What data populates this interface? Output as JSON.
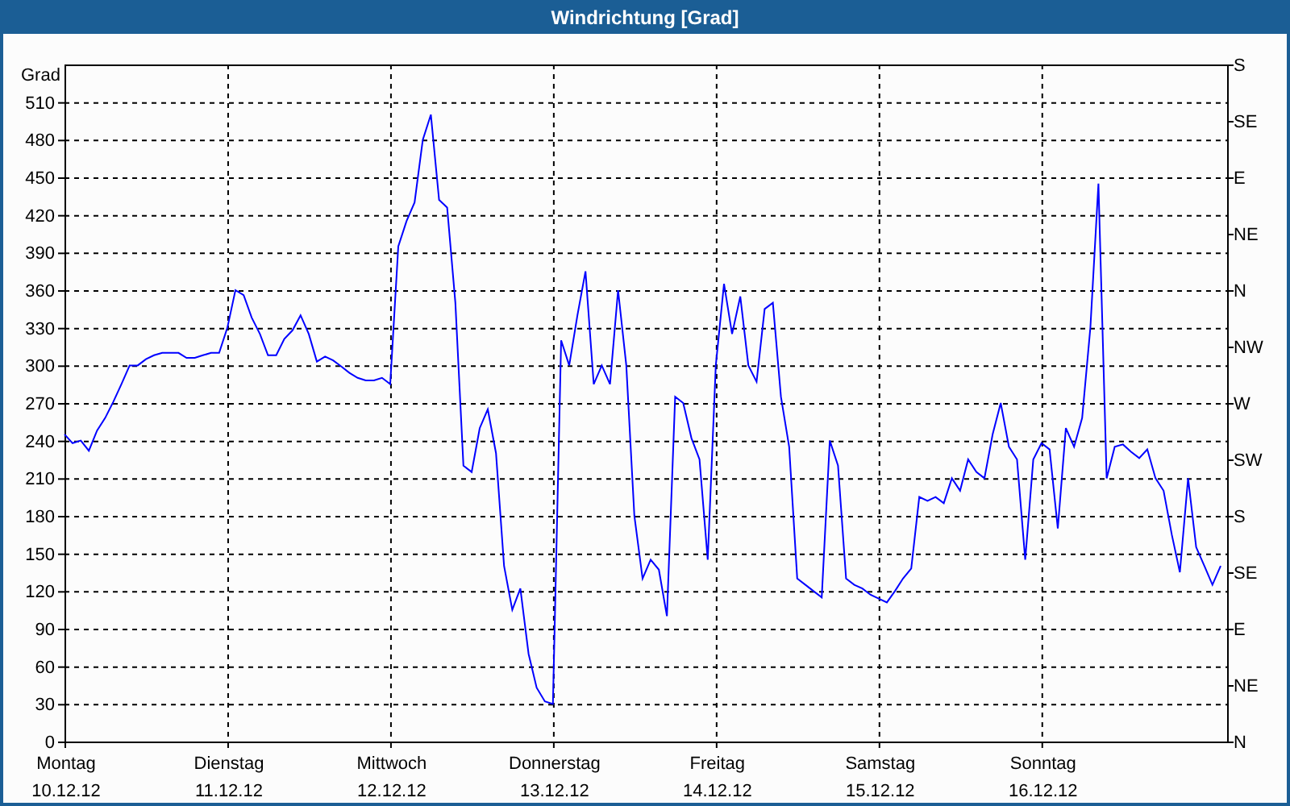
{
  "window": {
    "title": "Windrichtung [Grad]"
  },
  "chart": {
    "right_axis_labels": [
      "S",
      "SE",
      "E",
      "NE",
      "N",
      "NW",
      "W",
      "SW",
      "S",
      "SE",
      "E",
      "NE",
      "N"
    ],
    "dates": [
      "10.12.12",
      "11.12.12",
      "12.12.12",
      "13.12.12",
      "14.12.12",
      "15.12.12",
      "16.12.12"
    ],
    "chart_data": {
      "type": "line",
      "ylabel": "Grad",
      "grid": true,
      "ylim": [
        0,
        540
      ],
      "yticks": [
        0,
        30,
        60,
        90,
        120,
        150,
        180,
        210,
        240,
        270,
        300,
        330,
        360,
        390,
        420,
        450,
        480,
        510
      ],
      "categories": [
        "Montag",
        null,
        null,
        null,
        null,
        null,
        null,
        null,
        null,
        null,
        null,
        null,
        null,
        null,
        null,
        null,
        null,
        null,
        null,
        null,
        "Dienstag",
        null,
        null,
        null,
        null,
        null,
        null,
        null,
        null,
        null,
        null,
        null,
        null,
        null,
        null,
        null,
        null,
        null,
        null,
        null,
        "Mittwoch",
        null,
        null,
        null,
        null,
        null,
        null,
        null,
        null,
        null,
        null,
        null,
        null,
        null,
        null,
        null,
        null,
        null,
        null,
        null,
        "Donnerstag",
        null,
        null,
        null,
        null,
        null,
        null,
        null,
        null,
        null,
        null,
        null,
        null,
        null,
        null,
        null,
        null,
        null,
        null,
        null,
        "Freitag",
        null,
        null,
        null,
        null,
        null,
        null,
        null,
        null,
        null,
        null,
        null,
        null,
        null,
        null,
        null,
        null,
        null,
        null,
        null,
        "Samstag",
        null,
        null,
        null,
        null,
        null,
        null,
        null,
        null,
        null,
        null,
        null,
        null,
        null,
        null,
        null,
        null,
        null,
        null,
        null,
        "Sonntag",
        null,
        null,
        null,
        null,
        null,
        null,
        null,
        null,
        null,
        null,
        null,
        null,
        null,
        null,
        null,
        null,
        null,
        null,
        null,
        null,
        null,
        null
      ],
      "series": [
        {
          "color": "#0000ff",
          "values": [
            245,
            238,
            240,
            232,
            248,
            258,
            271,
            285,
            300,
            300,
            305,
            308,
            310,
            310,
            310,
            306,
            306,
            308,
            310,
            310,
            330,
            360,
            356,
            338,
            325,
            308,
            308,
            321,
            328,
            340,
            325,
            303,
            307,
            304,
            299,
            294,
            290,
            288,
            288,
            290,
            285,
            395,
            415,
            430,
            480,
            500,
            432,
            426,
            350,
            220,
            215,
            250,
            265,
            230,
            140,
            105,
            122,
            70,
            43,
            32,
            30,
            320,
            300,
            340,
            375,
            285,
            300,
            285,
            360,
            300,
            180,
            130,
            145,
            137,
            100,
            275,
            270,
            242,
            225,
            145,
            300,
            365,
            325,
            355,
            300,
            287,
            345,
            350,
            275,
            235,
            130,
            125,
            120,
            115,
            240,
            220,
            130,
            125,
            122,
            117,
            114,
            111,
            120,
            130,
            138,
            195,
            192,
            195,
            190,
            210,
            200,
            225,
            215,
            210,
            245,
            270,
            235,
            225,
            145,
            225,
            238,
            233,
            170,
            250,
            235,
            258,
            330,
            445,
            210,
            235,
            237,
            231,
            226,
            233,
            210,
            200,
            165,
            135,
            210,
            155,
            140,
            125,
            140
          ]
        }
      ]
    }
  }
}
